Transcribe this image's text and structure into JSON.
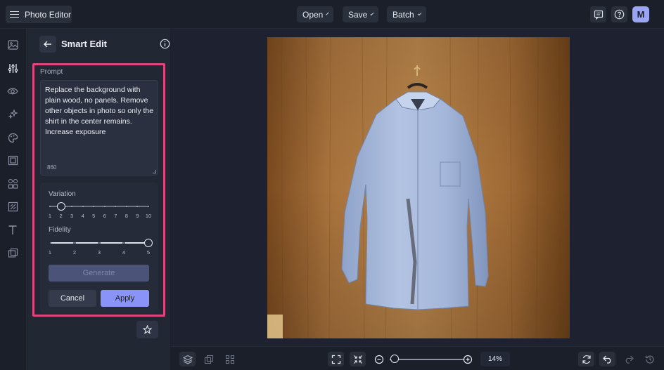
{
  "app": {
    "title": "Photo Editor"
  },
  "toolbar": {
    "open_label": "Open",
    "save_label": "Save",
    "batch_label": "Batch",
    "avatar_initial": "M"
  },
  "rail": {
    "items": [
      "image-icon",
      "adjust-icon",
      "eye-icon",
      "sparkle-icon",
      "palette-icon",
      "frame-icon",
      "shapes-icon",
      "texture-icon",
      "text-icon",
      "graphics-icon"
    ]
  },
  "panel": {
    "title": "Smart Edit",
    "prompt_label": "Prompt",
    "prompt_text": "Replace the background with plain wood, no panels. Remove other objects in photo so only the shirt in the center remains. Increase exposure",
    "char_count": "860",
    "variation": {
      "label": "Variation",
      "ticks": [
        "1",
        "2",
        "3",
        "4",
        "5",
        "6",
        "7",
        "8",
        "9",
        "10"
      ],
      "value": 2
    },
    "fidelity": {
      "label": "Fidelity",
      "ticks": [
        "1",
        "2",
        "3",
        "4",
        "5"
      ],
      "value": 5
    },
    "generate_label": "Generate",
    "cancel_label": "Cancel",
    "apply_label": "Apply"
  },
  "zoom": {
    "value": "14%"
  },
  "colors": {
    "accent": "#8a94f8",
    "highlight": "#e0467c",
    "background": "#1b1f2a"
  }
}
